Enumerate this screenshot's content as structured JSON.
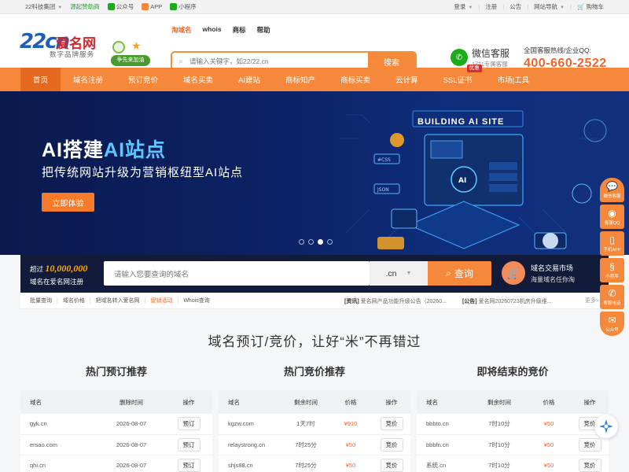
{
  "topbar": {
    "group": "22科技集团",
    "sponsor": "源起赞助商",
    "gzh": "公众号",
    "app": "APP",
    "mini": "小程序",
    "login": "登录",
    "register": "注册",
    "notice": "公告",
    "sitenav": "网站导航",
    "cart": "购物车"
  },
  "header": {
    "logo_num": "22cn",
    "logo_cn": "爱名网",
    "logo_sub": "数字品牌服务",
    "mascot_text": "争先来加油",
    "tabs": [
      "淘域名",
      "whois",
      "商标",
      "帮助"
    ],
    "search_placeholder": "请输入关键字，如22/22.cn",
    "search_btn": "搜索",
    "wechat_title": "微信客服",
    "wechat_sub": "1对1专属客服",
    "hotline_label": "全国客服热线/企业QQ:",
    "hotline_number": "400-660-2522"
  },
  "nav": {
    "items": [
      "首页",
      "域名注册",
      "预订竞价",
      "域名买卖",
      "AI建站",
      "商标知产",
      "商标买卖",
      "云计算",
      "SSL证书",
      "市场|工具"
    ],
    "ssl_tag": "优惠"
  },
  "banner": {
    "title_a": "AI搭建",
    "title_b": "AI站点",
    "subtitle": "把传统网站升级为营销枢纽型AI站点",
    "cta": "立即体验",
    "art_title": "BUILDING AI SITE"
  },
  "domain_search": {
    "label_prefix": "超过",
    "label_count": "10,000,000",
    "label_suffix": "域名在爱名网注册",
    "placeholder": "请输入您要查询的域名",
    "suffix": ".cn",
    "button": "查询",
    "market_title": "域名交易市场",
    "market_sub": "海量域名任你淘"
  },
  "quick": {
    "links": [
      "批量查询",
      "域名价格",
      "把域名转入爱名网",
      "促销活动",
      "Whois查询"
    ],
    "news1_tag": "[资讯]",
    "news1": "爱名网产品功能升级公告（20260...",
    "news2_tag": "[公告]",
    "news2": "爱名网20260723机房升级维...",
    "more": "更多»"
  },
  "main": {
    "slogan": "域名预订/竞价，让好“米”不再错过",
    "col1_title": "热门预订推荐",
    "col2_title": "热门竞价推荐",
    "col3_title": "即将结束的竞价",
    "t1_head": [
      "域名",
      "删除时间",
      "操作"
    ],
    "t1_rows": [
      [
        "gyk.cn",
        "2026-08-07",
        "预订"
      ],
      [
        "ersao.com",
        "2026-08-07",
        "预订"
      ],
      [
        "qhi.cn",
        "2026-08-07",
        "预订"
      ]
    ],
    "t2_head": [
      "域名",
      "剩余时间",
      "价格",
      "操作"
    ],
    "t2_rows": [
      [
        "kgzw.com",
        "1天7时",
        "¥910",
        "竞价"
      ],
      [
        "relaystrong.cn",
        "7时25分",
        "¥50",
        "竞价"
      ],
      [
        "shjs88.cn",
        "7时25分",
        "¥50",
        "竞价"
      ]
    ],
    "t3_head": [
      "域名",
      "剩余时间",
      "价格",
      "操作"
    ],
    "t3_rows": [
      [
        "bbbto.cn",
        "7时10分",
        "¥50",
        "竞价"
      ],
      [
        "bbbfn.cn",
        "7时10分",
        "¥50",
        "竞价"
      ],
      [
        "系统.cn",
        "7时10分",
        "¥50",
        "竞价"
      ]
    ]
  },
  "float": {
    "items": [
      "微信客服",
      "客服QQ",
      "手机APP",
      "小程序",
      "客服电话",
      "公众号"
    ]
  }
}
